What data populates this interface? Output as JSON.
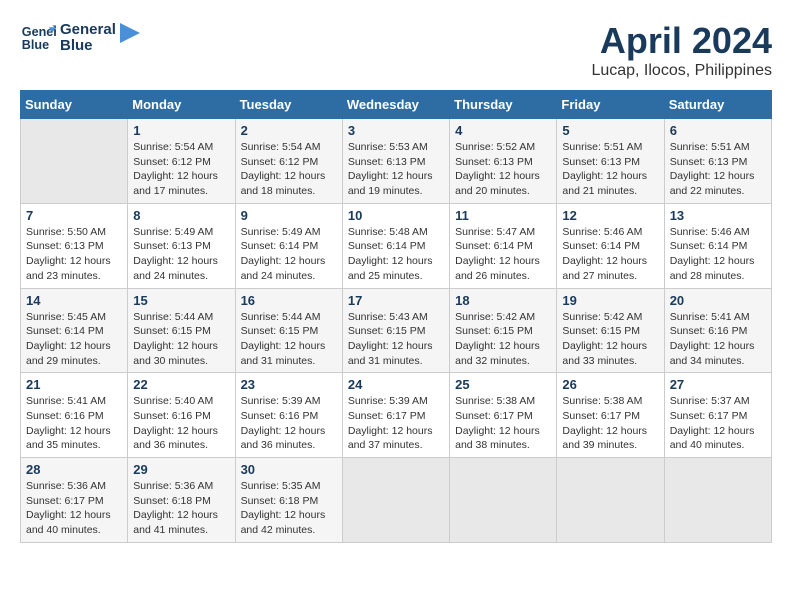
{
  "logo": {
    "line1": "General",
    "line2": "Blue"
  },
  "title": "April 2024",
  "subtitle": "Lucap, Ilocos, Philippines",
  "days_of_week": [
    "Sunday",
    "Monday",
    "Tuesday",
    "Wednesday",
    "Thursday",
    "Friday",
    "Saturday"
  ],
  "weeks": [
    [
      {
        "num": "",
        "info": ""
      },
      {
        "num": "1",
        "info": "Sunrise: 5:54 AM\nSunset: 6:12 PM\nDaylight: 12 hours\nand 17 minutes."
      },
      {
        "num": "2",
        "info": "Sunrise: 5:54 AM\nSunset: 6:12 PM\nDaylight: 12 hours\nand 18 minutes."
      },
      {
        "num": "3",
        "info": "Sunrise: 5:53 AM\nSunset: 6:13 PM\nDaylight: 12 hours\nand 19 minutes."
      },
      {
        "num": "4",
        "info": "Sunrise: 5:52 AM\nSunset: 6:13 PM\nDaylight: 12 hours\nand 20 minutes."
      },
      {
        "num": "5",
        "info": "Sunrise: 5:51 AM\nSunset: 6:13 PM\nDaylight: 12 hours\nand 21 minutes."
      },
      {
        "num": "6",
        "info": "Sunrise: 5:51 AM\nSunset: 6:13 PM\nDaylight: 12 hours\nand 22 minutes."
      }
    ],
    [
      {
        "num": "7",
        "info": "Sunrise: 5:50 AM\nSunset: 6:13 PM\nDaylight: 12 hours\nand 23 minutes."
      },
      {
        "num": "8",
        "info": "Sunrise: 5:49 AM\nSunset: 6:13 PM\nDaylight: 12 hours\nand 24 minutes."
      },
      {
        "num": "9",
        "info": "Sunrise: 5:49 AM\nSunset: 6:14 PM\nDaylight: 12 hours\nand 24 minutes."
      },
      {
        "num": "10",
        "info": "Sunrise: 5:48 AM\nSunset: 6:14 PM\nDaylight: 12 hours\nand 25 minutes."
      },
      {
        "num": "11",
        "info": "Sunrise: 5:47 AM\nSunset: 6:14 PM\nDaylight: 12 hours\nand 26 minutes."
      },
      {
        "num": "12",
        "info": "Sunrise: 5:46 AM\nSunset: 6:14 PM\nDaylight: 12 hours\nand 27 minutes."
      },
      {
        "num": "13",
        "info": "Sunrise: 5:46 AM\nSunset: 6:14 PM\nDaylight: 12 hours\nand 28 minutes."
      }
    ],
    [
      {
        "num": "14",
        "info": "Sunrise: 5:45 AM\nSunset: 6:14 PM\nDaylight: 12 hours\nand 29 minutes."
      },
      {
        "num": "15",
        "info": "Sunrise: 5:44 AM\nSunset: 6:15 PM\nDaylight: 12 hours\nand 30 minutes."
      },
      {
        "num": "16",
        "info": "Sunrise: 5:44 AM\nSunset: 6:15 PM\nDaylight: 12 hours\nand 31 minutes."
      },
      {
        "num": "17",
        "info": "Sunrise: 5:43 AM\nSunset: 6:15 PM\nDaylight: 12 hours\nand 31 minutes."
      },
      {
        "num": "18",
        "info": "Sunrise: 5:42 AM\nSunset: 6:15 PM\nDaylight: 12 hours\nand 32 minutes."
      },
      {
        "num": "19",
        "info": "Sunrise: 5:42 AM\nSunset: 6:15 PM\nDaylight: 12 hours\nand 33 minutes."
      },
      {
        "num": "20",
        "info": "Sunrise: 5:41 AM\nSunset: 6:16 PM\nDaylight: 12 hours\nand 34 minutes."
      }
    ],
    [
      {
        "num": "21",
        "info": "Sunrise: 5:41 AM\nSunset: 6:16 PM\nDaylight: 12 hours\nand 35 minutes."
      },
      {
        "num": "22",
        "info": "Sunrise: 5:40 AM\nSunset: 6:16 PM\nDaylight: 12 hours\nand 36 minutes."
      },
      {
        "num": "23",
        "info": "Sunrise: 5:39 AM\nSunset: 6:16 PM\nDaylight: 12 hours\nand 36 minutes."
      },
      {
        "num": "24",
        "info": "Sunrise: 5:39 AM\nSunset: 6:17 PM\nDaylight: 12 hours\nand 37 minutes."
      },
      {
        "num": "25",
        "info": "Sunrise: 5:38 AM\nSunset: 6:17 PM\nDaylight: 12 hours\nand 38 minutes."
      },
      {
        "num": "26",
        "info": "Sunrise: 5:38 AM\nSunset: 6:17 PM\nDaylight: 12 hours\nand 39 minutes."
      },
      {
        "num": "27",
        "info": "Sunrise: 5:37 AM\nSunset: 6:17 PM\nDaylight: 12 hours\nand 40 minutes."
      }
    ],
    [
      {
        "num": "28",
        "info": "Sunrise: 5:36 AM\nSunset: 6:17 PM\nDaylight: 12 hours\nand 40 minutes."
      },
      {
        "num": "29",
        "info": "Sunrise: 5:36 AM\nSunset: 6:18 PM\nDaylight: 12 hours\nand 41 minutes."
      },
      {
        "num": "30",
        "info": "Sunrise: 5:35 AM\nSunset: 6:18 PM\nDaylight: 12 hours\nand 42 minutes."
      },
      {
        "num": "",
        "info": ""
      },
      {
        "num": "",
        "info": ""
      },
      {
        "num": "",
        "info": ""
      },
      {
        "num": "",
        "info": ""
      }
    ]
  ]
}
